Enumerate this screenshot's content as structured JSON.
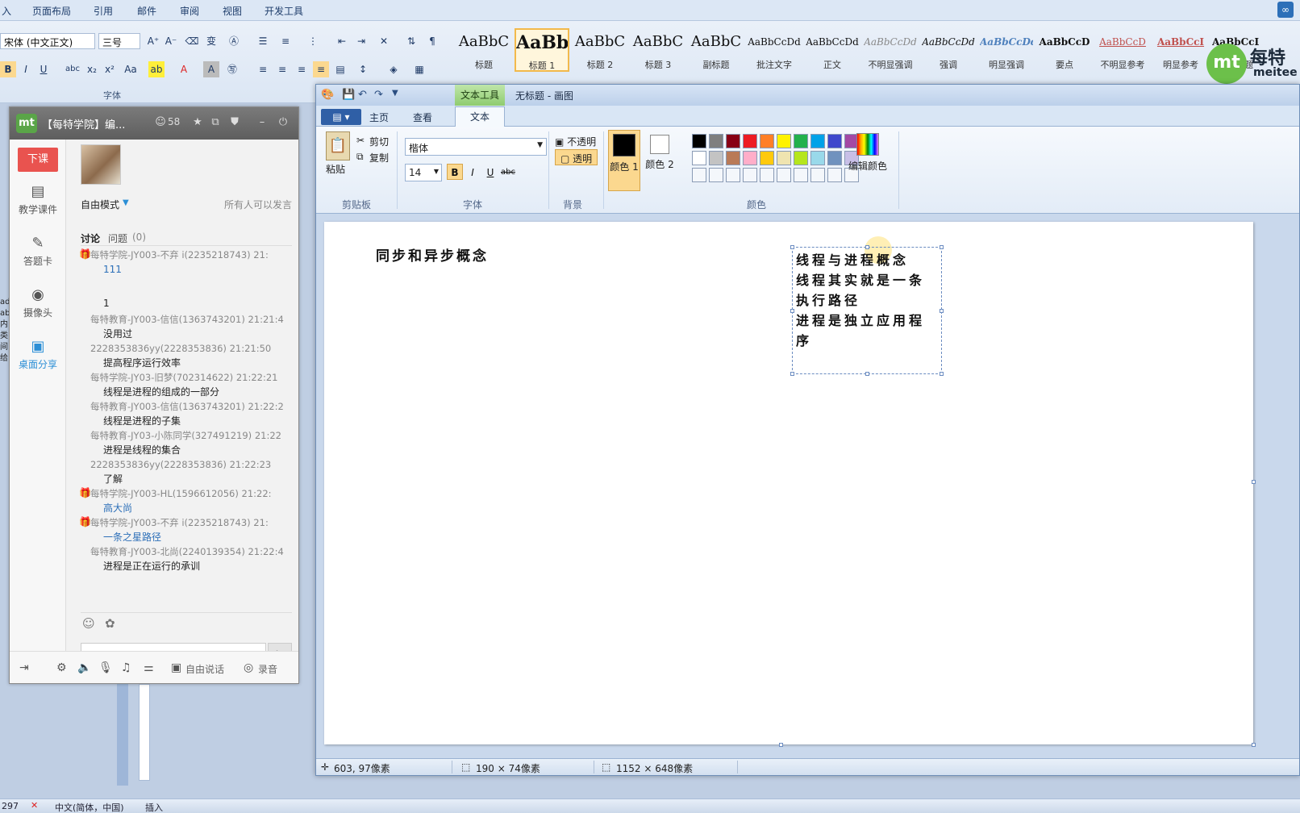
{
  "word": {
    "tabs": [
      "入",
      "页面布局",
      "引用",
      "邮件",
      "审阅",
      "视图",
      "开发工具"
    ],
    "font_name": "宋体 (中文正文)",
    "font_size": "三号",
    "group_font_label": "字体",
    "styles": [
      {
        "sample": "AaBbC",
        "name": "标题"
      },
      {
        "sample": "AaBb",
        "name": "标题 1"
      },
      {
        "sample": "AaBbC",
        "name": "标题 2"
      },
      {
        "sample": "AaBbC",
        "name": "标题 3"
      },
      {
        "sample": "AaBbC",
        "name": "副标题"
      },
      {
        "sample": "AaBbCcDd",
        "name": "批注文字"
      },
      {
        "sample": "AaBbCcDd",
        "name": "正文"
      },
      {
        "sample": "AaBbCcDd",
        "name": "不明显强调"
      },
      {
        "sample": "AaBbCcDd",
        "name": "强调"
      },
      {
        "sample": "AaBbCcDd",
        "name": "明显强调"
      },
      {
        "sample": "AaBbCcD",
        "name": "要点"
      },
      {
        "sample": "AaBbCcD",
        "name": "不明显参考"
      },
      {
        "sample": "AaBbCcI",
        "name": "明显参考"
      },
      {
        "sample": "AaBbCcL",
        "name": "书籍标题"
      }
    ],
    "logo_cn": "每特",
    "logo_en": "meitee",
    "left_edge_text": "ad ab 内 类 间 给",
    "status": {
      "page": "297",
      "language": "中文(简体，中国)",
      "mode": "插入"
    }
  },
  "classroom": {
    "title": "【每特学院】编...",
    "member_count": "58",
    "dismiss_label": "下课",
    "nav": [
      {
        "label": "教学课件",
        "icon": "courseware-icon"
      },
      {
        "label": "答题卡",
        "icon": "answer-card-icon"
      },
      {
        "label": "摄像头",
        "icon": "camera-icon"
      },
      {
        "label": "桌面分享",
        "icon": "desktop-share-icon"
      }
    ],
    "mode_label": "自由模式",
    "all_can_speak": "所有人可以发言",
    "tab_discussion": "讨论",
    "tab_questions": "问题",
    "question_count": "(0)",
    "messages": [
      {
        "who": "每特学院-JY003-不弃 i(2235218743) 21:",
        "text": "111",
        "gift": true,
        "blue": true
      },
      {
        "who": "",
        "text": "1",
        "gift": false,
        "blue": false
      },
      {
        "who": "每特教育-JY003-信信(1363743201) 21:21:4",
        "text": "没用过",
        "gift": false,
        "blue": false
      },
      {
        "who": "2228353836yy(2228353836) 21:21:50",
        "text": "提高程序运行效率",
        "gift": false,
        "blue": false
      },
      {
        "who": "每特学院-JY03-旧梦(702314622) 21:22:21",
        "text": "线程是进程的组成的一部分",
        "gift": false,
        "blue": false
      },
      {
        "who": "每特教育-JY003-信信(1363743201) 21:22:2",
        "text": "线程是进程的子集",
        "gift": false,
        "blue": false
      },
      {
        "who": "每特教育-JY03-小陈同学(327491219) 21:22",
        "text": "进程是线程的集合",
        "gift": false,
        "blue": false
      },
      {
        "who": "2228353836yy(2228353836) 21:22:23",
        "text": "了解",
        "gift": false,
        "blue": false
      },
      {
        "who": "每特学院-JY003-HL(1596612056) 21:22:",
        "text": "高大尚",
        "gift": true,
        "blue": true
      },
      {
        "who": "每特学院-JY003-不弃 i(2235218743) 21:",
        "text": "一条之星路径",
        "gift": true,
        "blue": true
      },
      {
        "who": "每特教育-JY003-北尚(2240139354) 21:22:4",
        "text": "进程是正在运行的承训",
        "gift": false,
        "blue": false
      }
    ],
    "bottom_free_talk": "自由说话",
    "bottom_record": "录音"
  },
  "paint": {
    "context_tab": "文本工具",
    "window_title": "无标题 - 画图",
    "tabs": [
      "主页",
      "查看",
      "文本"
    ],
    "active_tab": "文本",
    "clipboard": {
      "paste": "粘贴",
      "cut": "剪切",
      "copy": "复制",
      "label": "剪贴板"
    },
    "font": {
      "name": "楷体",
      "size": "14",
      "label": "字体"
    },
    "background": {
      "opaque": "不透明",
      "transparent": "透明",
      "label": "背景"
    },
    "colors": {
      "color1": "颜色 1",
      "color2": "颜色 2",
      "edit": "编辑颜色",
      "label": "颜色",
      "palette": [
        "#000000",
        "#7f7f7f",
        "#880015",
        "#ed1c24",
        "#ff7f27",
        "#fff200",
        "#22b14c",
        "#00a2e8",
        "#3f48cc",
        "#a349a4",
        "#ffffff",
        "#c3c3c3",
        "#b97a57",
        "#ffaec9",
        "#ffc90e",
        "#efe4b0",
        "#b5e61d",
        "#99d9ea",
        "#7092be",
        "#c8bfe7"
      ]
    },
    "canvas": {
      "heading": "同步和异步概念",
      "textbox_lines": [
        "线程与进程概念",
        "线程其实就是一条",
        "执行路径",
        "进程是独立应用程",
        "序"
      ]
    },
    "status": {
      "cursor": "603, 97像素",
      "selection": "190 × 74像素",
      "canvas_size": "1152 × 648像素"
    }
  }
}
